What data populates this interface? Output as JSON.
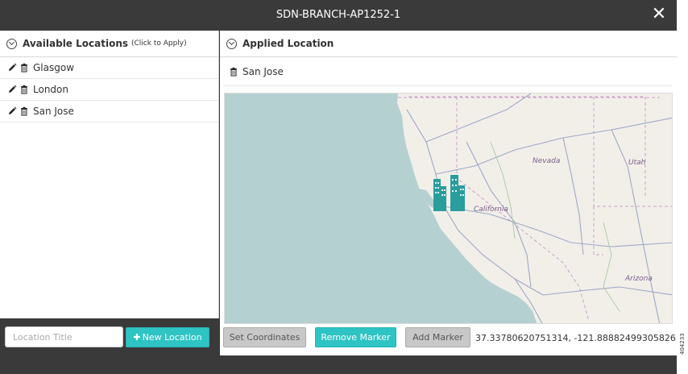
{
  "dialog": {
    "title": "SDN-BRANCH-AP1252-1",
    "close_label": "✕"
  },
  "left_panel": {
    "header": "Available Locations",
    "header_hint": "(Click to Apply)",
    "locations": [
      {
        "label": "Glasgow"
      },
      {
        "label": "London"
      },
      {
        "label": "San Jose"
      }
    ],
    "input_placeholder": "Location Title",
    "input_value": "",
    "new_location_label": "New Location"
  },
  "right_panel": {
    "header": "Applied Location",
    "applied": "San Jose",
    "map": {
      "labels": {
        "nevada": "Nevada",
        "utah": "Utah",
        "california": "California",
        "arizona": "Arizona"
      },
      "colors": {
        "water": "#b5d0d0",
        "land": "#f2efe9",
        "marker": "#2a9d9d"
      }
    },
    "buttons": {
      "set_coordinates": "Set Coordinates",
      "remove_marker": "Remove Marker",
      "add_marker": "Add Marker"
    },
    "coordinates": "37.33780620751314, -121.88882499305826"
  },
  "side_id": "404233"
}
